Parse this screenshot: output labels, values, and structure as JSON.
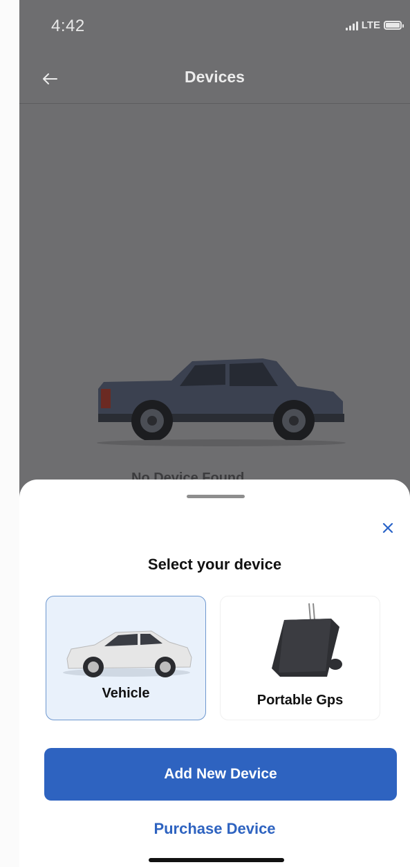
{
  "status_bar": {
    "time": "4:42",
    "network": "LTE",
    "signal_bars": 4,
    "battery_level": 1.0
  },
  "nav": {
    "back_icon": "arrow-left-icon",
    "title": "Devices"
  },
  "background": {
    "hero_image": "pickup-truck-image",
    "caption": "No Device Found"
  },
  "sheet": {
    "title": "Select your device",
    "close_icon": "close-icon",
    "options": [
      {
        "label": "Vehicle",
        "image": "sedan-car-image",
        "selected": true
      },
      {
        "label": "Portable Gps",
        "image": "gps-tracker-image",
        "selected": false
      }
    ],
    "primary_action": "Add New Device",
    "secondary_action": "Purchase Device"
  },
  "colors": {
    "accent": "#2e63c0",
    "selected_card_bg": "#e9f1fb",
    "selected_card_border": "#6d97cf",
    "overlay": "#6e6e70"
  }
}
